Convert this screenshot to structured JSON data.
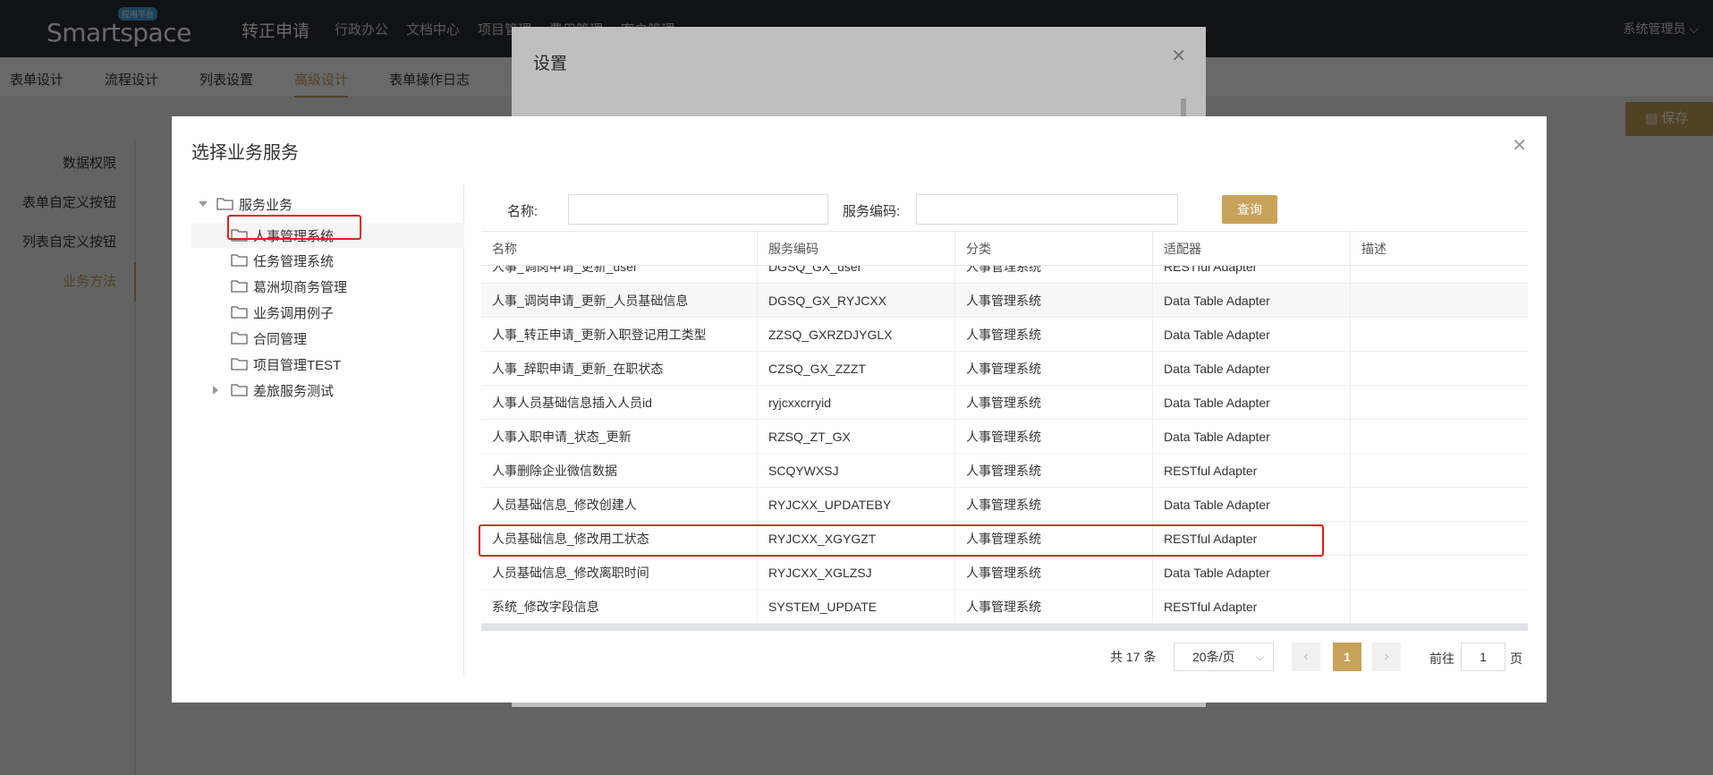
{
  "topbar": {
    "logo_text": "Smartspace",
    "logo_badge": "应用平台",
    "app_title": "转正申请",
    "nav": [
      "行政办公",
      "文档中心",
      "项目管理",
      "费用管理",
      "客户管理"
    ],
    "user": "系统管理员"
  },
  "subtabs": [
    "表单设计",
    "流程设计",
    "列表设置",
    "高级设计",
    "表单操作日志"
  ],
  "save_label": "保存",
  "leftmenu": [
    "数据权限",
    "表单自定义按钮",
    "列表自定义按钮",
    "业务方法"
  ],
  "settings_dialog": {
    "title": "设置"
  },
  "dialog": {
    "title": "选择业务服务",
    "tree": {
      "root": "服务业务",
      "items": [
        "人事管理系统",
        "任务管理系统",
        "葛洲坝商务管理",
        "业务调用例子",
        "合同管理",
        "项目管理TEST",
        "差旅服务测试"
      ],
      "selected": "人事管理系统"
    },
    "search": {
      "name_label": "名称:",
      "name_value": "",
      "code_label": "服务编码:",
      "code_value": "",
      "query_label": "查询"
    },
    "table": {
      "columns": [
        "名称",
        "服务编码",
        "分类",
        "适配器",
        "描述"
      ],
      "rows": [
        [
          "人事_调岗申请_更新_user",
          "DGSQ_GX_user",
          "人事管理系统",
          "RESTful Adapter",
          ""
        ],
        [
          "人事_调岗申请_更新_人员基础信息",
          "DGSQ_GX_RYJCXX",
          "人事管理系统",
          "Data Table Adapter",
          ""
        ],
        [
          "人事_转正申请_更新入职登记用工类型",
          "ZZSQ_GXRZDJYGLX",
          "人事管理系统",
          "Data Table Adapter",
          ""
        ],
        [
          "人事_辞职申请_更新_在职状态",
          "CZSQ_GX_ZZZT",
          "人事管理系统",
          "Data Table Adapter",
          ""
        ],
        [
          "人事人员基础信息插入人员id",
          "ryjcxxcrryid",
          "人事管理系统",
          "Data Table Adapter",
          ""
        ],
        [
          "人事入职申请_状态_更新",
          "RZSQ_ZT_GX",
          "人事管理系统",
          "Data Table Adapter",
          ""
        ],
        [
          "人事删除企业微信数据",
          "SCQYWXSJ",
          "人事管理系统",
          "RESTful Adapter",
          ""
        ],
        [
          "人员基础信息_修改创建人",
          "RYJCXX_UPDATEBY",
          "人事管理系统",
          "Data Table Adapter",
          ""
        ],
        [
          "人员基础信息_修改用工状态",
          "RYJCXX_XGYGZT",
          "人事管理系统",
          "RESTful Adapter",
          ""
        ],
        [
          "人员基础信息_修改离职时间",
          "RYJCXX_XGLZSJ",
          "人事管理系统",
          "Data Table Adapter",
          ""
        ],
        [
          "系统_修改字段信息",
          "SYSTEM_UPDATE",
          "人事管理系统",
          "RESTful Adapter",
          ""
        ]
      ],
      "highlighted_row": "人员基础信息_修改用工状态"
    },
    "pagination": {
      "total": "共 17 条",
      "page_size": "20条/页",
      "prev": "‹",
      "current": "1",
      "next": "›",
      "goto_label": "前往",
      "goto_value": "1",
      "page_suffix": "页"
    }
  },
  "colors": {
    "accent": "#c9a25a",
    "topbar": "#2b2d33",
    "highlight": "#e02020"
  }
}
